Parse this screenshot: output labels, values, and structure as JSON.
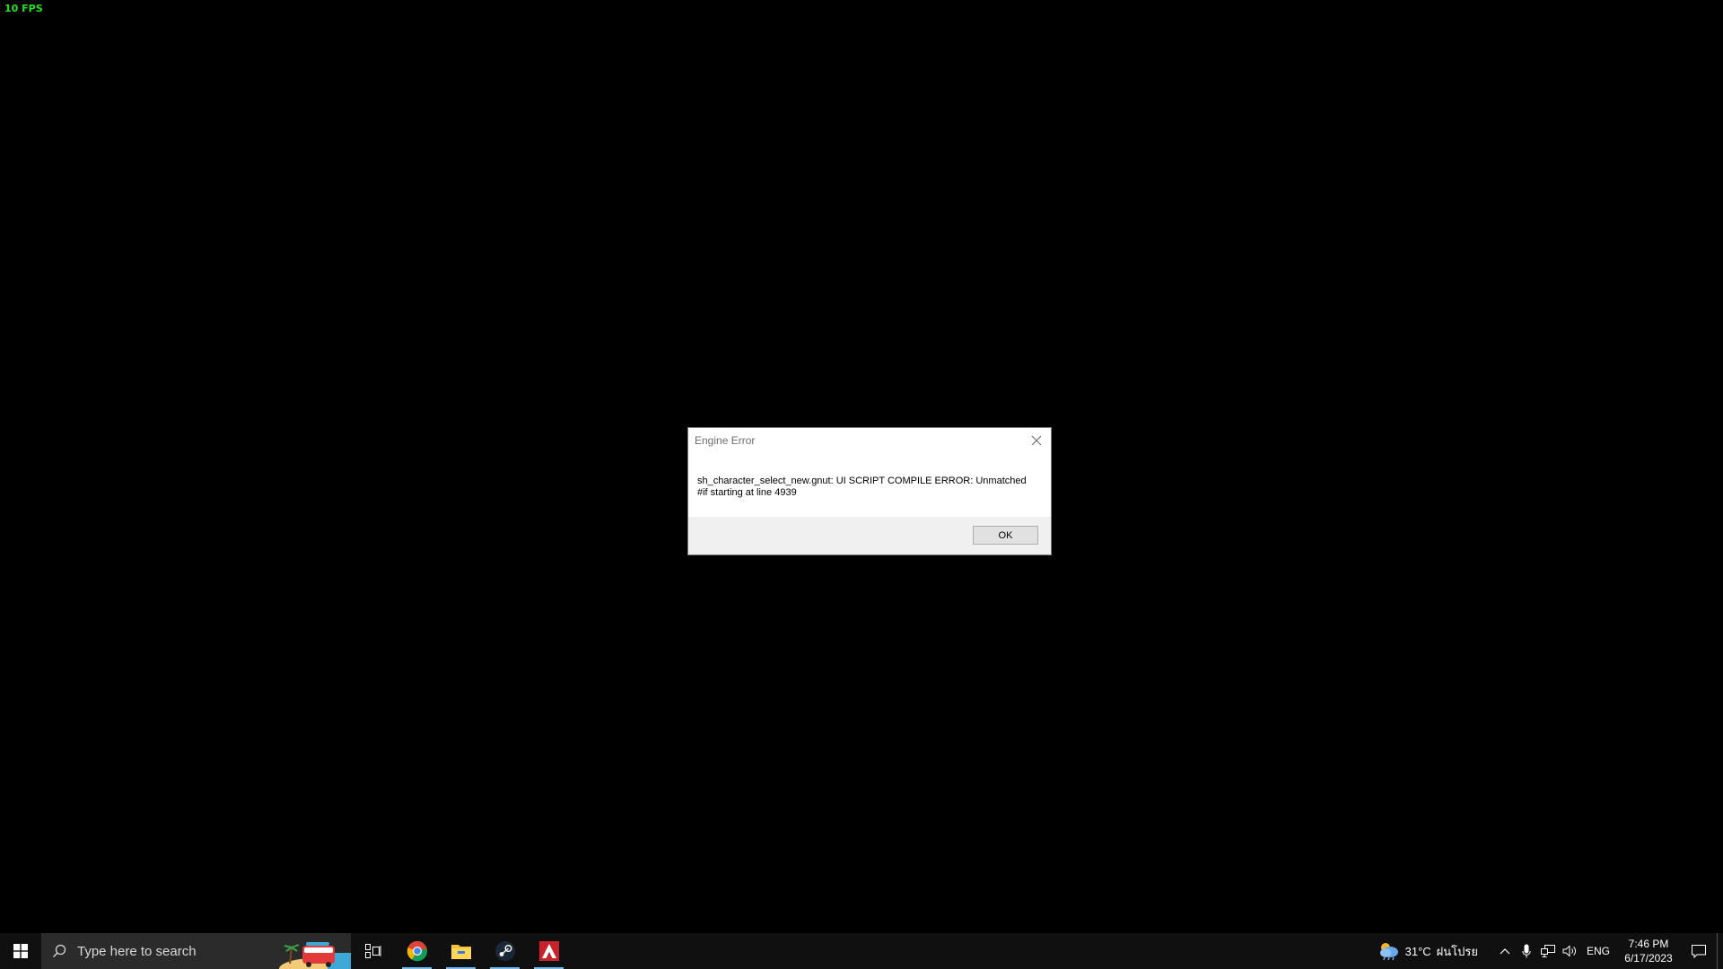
{
  "overlay": {
    "fps_text": "10 FPS"
  },
  "dialog": {
    "title": "Engine Error",
    "message_line1": "sh_character_select_new.gnut: UI SCRIPT COMPILE ERROR: Unmatched",
    "message_line2": "#if starting at line 4939",
    "ok_label": "OK",
    "close_icon": "close-icon"
  },
  "taskbar": {
    "search_placeholder": "Type here to search",
    "pinned_apps": [
      {
        "name": "Task View",
        "icon": "task-view-icon",
        "running": false
      },
      {
        "name": "Google Chrome",
        "icon": "chrome-icon",
        "running": true
      },
      {
        "name": "File Explorer",
        "icon": "folder-icon",
        "running": true
      },
      {
        "name": "Steam",
        "icon": "steam-icon",
        "running": true
      },
      {
        "name": "Apex Legends",
        "icon": "apex-icon",
        "running": true
      }
    ],
    "tray": {
      "weather_temp": "31°C",
      "weather_desc": "ฝนโปรย",
      "language": "ENG",
      "time": "7:46 PM",
      "date": "6/17/2023"
    }
  },
  "colors": {
    "fps_green": "#22e51a",
    "accent_blue": "#0078d7",
    "taskbar_bg": "#101010"
  }
}
